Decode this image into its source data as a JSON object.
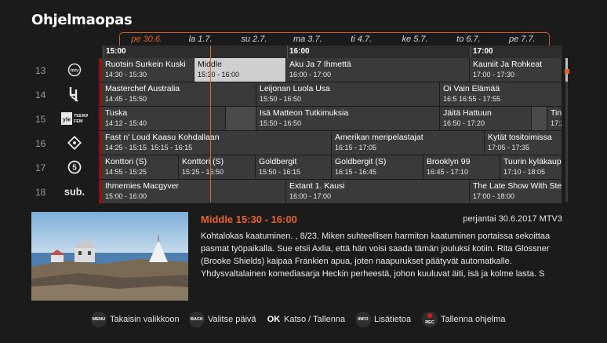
{
  "page": {
    "title": "Ohjelmaopas"
  },
  "days": [
    "pe 30.6.",
    "la 1.7.",
    "su 2.7.",
    "ma 3.7.",
    "ti 4.7.",
    "ke 5.7.",
    "to 6.7.",
    "pe 7.7."
  ],
  "timeline": {
    "labels": [
      "15:00",
      "16:00",
      "17:00"
    ]
  },
  "channels": [
    {
      "number": "13",
      "logo": "mtv3-logo",
      "programs": [
        {
          "title": "Ruotsin Surkein Kuski",
          "time": "14:30 - 15:30"
        },
        {
          "title": "Middle",
          "time": "15:30 - 16:00"
        },
        {
          "title": "Aku Ja 7 Ihmettä",
          "time": "16:00 - 17:00"
        },
        {
          "title": "Kauniit Ja Rohkeat",
          "time": "17:00 - 17:30"
        }
      ]
    },
    {
      "number": "14",
      "logo": "nelonen-logo",
      "programs": [
        {
          "title": "Masterchef Australia",
          "time": "14:45 - 15:50"
        },
        {
          "title": "Leijonan Luola Usa",
          "time": "15:50 - 16:50"
        },
        {
          "title": "Oi Vain Elämää",
          "time": "16:5 16:55 - 17:55"
        }
      ]
    },
    {
      "number": "15",
      "logo": "yle-teema-fem-logo",
      "programs": [
        {
          "title": "Tuska",
          "time": "14:12 - 15:40"
        },
        {
          "title": "",
          "time": ""
        },
        {
          "title": "Isä Matteon Tutkimuksia",
          "time": "15:50 - 16:50"
        },
        {
          "title": "Jäitä Hattuun",
          "time": "16:50 - 17:20"
        },
        {
          "title": "",
          "time": ""
        },
        {
          "title": "Tina",
          "time": "17:2"
        }
      ]
    },
    {
      "number": "16",
      "logo": "fox-logo",
      "programs": [
        {
          "title": "Fast n' Loud Kaasu Kohdallaan",
          "time": "14:25 - 15:15"
        },
        {
          "title": "Fast n' Loud Kaasu Kohdallaan",
          "time": "15:15 - 16:15"
        },
        {
          "title": "Amerikan meripelastajat",
          "time": "16:15 - 17:05"
        },
        {
          "title": "Kytät tositoimissa",
          "time": "17:05 - 17:35"
        }
      ]
    },
    {
      "number": "17",
      "logo": "viisi-logo",
      "programs": [
        {
          "title": "Konttori (S)",
          "time": "14:55 - 15:25"
        },
        {
          "title": "Konttori (S)",
          "time": "15:25 - 15:50"
        },
        {
          "title": "Goldbergit",
          "time": "15:50 - 16:15"
        },
        {
          "title": "Goldbergit (S)",
          "time": "16:15 - 16:45"
        },
        {
          "title": "Brooklyn 99",
          "time": "16:45 - 17:10"
        },
        {
          "title": "Tuurin kyläkaup",
          "time": "17:10 - 18:05"
        }
      ]
    },
    {
      "number": "18",
      "logo": "sub-logo",
      "programs": [
        {
          "title": "Ihmemies Macgyver",
          "time": "15:00 - 16:00"
        },
        {
          "title": "Extant 1. Kausi",
          "time": "16:00 - 17:00"
        },
        {
          "title": "The Late Show With Step",
          "time": "17:00 - 18:00"
        }
      ]
    }
  ],
  "detail": {
    "title": "Middle  15:30 - 16:00",
    "date": "perjantai 30.6.2017 MTV3",
    "description": "Kohtalokas kaatuminen. , 8/23. Miken suhteellisen harmiton kaatuminen portaissa sekoittaa pasmat työpaikalla. Sue etsii Axlia, että hän voisi saada tämän jouluksi kotiin. Rita Glossner (Brooke Shields) kaipaa Frankien apua, joten naapurukset päätyvät automatkalle. Yhdysvaltalainen komediasarja Heckin perheestä, johon kuuluvat äiti, isä ja kolme lasta. S"
  },
  "footer": [
    {
      "key": "MENU",
      "label": "Takaisin valikkoon"
    },
    {
      "key": "BACK",
      "label": "Valitse päivä"
    },
    {
      "key": "OK",
      "label": "Katso / Tallenna"
    },
    {
      "key": "INFO",
      "label": "Lisätietoa"
    },
    {
      "key": "REC",
      "label": "Tallenna ohjelma"
    }
  ],
  "colors": {
    "accent": "#e8622b",
    "channel_bar": "#8c1414",
    "cell": "#3a3a3a",
    "selected": "#cfcfcf"
  }
}
